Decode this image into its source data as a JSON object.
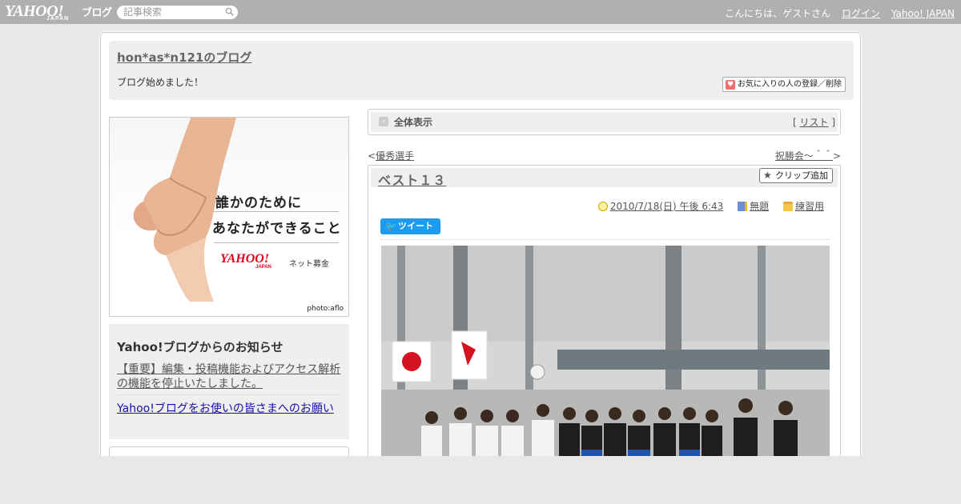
{
  "topbar": {
    "logo_text": "YAHOO!",
    "logo_sub": "JAPAN",
    "logo_blog": "ブログ",
    "search_placeholder": "記事検索",
    "greeting": "こんにちは、ゲストさん",
    "login": "ログイン",
    "yahoo_japan": "Yahoo! JAPAN"
  },
  "header": {
    "blog_title": "hon*as*n121のブログ",
    "description": "ブログ始めました！",
    "fav_button": "お気に入りの人の登録／削除"
  },
  "sidebar": {
    "banner": {
      "line1": "誰かのために",
      "line2": "あなたができること",
      "logo": "YAHOO!",
      "logo_sub": "JAPAN",
      "service": "ネット募金",
      "credit": "photo:aflo"
    },
    "notice": {
      "title": "Yahoo!ブログからのお知らせ",
      "items": [
        "【重要】編集・投稿機能およびアクセス解析の機能を停止いたしました。",
        "Yahoo!ブログをお使いの皆さまへのお願い"
      ]
    }
  },
  "main": {
    "all_view": "全体表示",
    "list_link": "リスト",
    "prev_link": "優秀選手",
    "next_link": "祝勝会～＾＾",
    "post": {
      "title": "ベスト１３",
      "clip_button": "クリップ追加",
      "date": "2010/7/18(日) 午後 6:43",
      "theme": "無題",
      "category": "練習用",
      "tweet": "ツイート"
    }
  },
  "colors": {
    "topbar": "#b0b0b0",
    "header_bg": "#efefef",
    "tweet_blue": "#1d9bf0",
    "yahoo_red": "#e60020"
  }
}
